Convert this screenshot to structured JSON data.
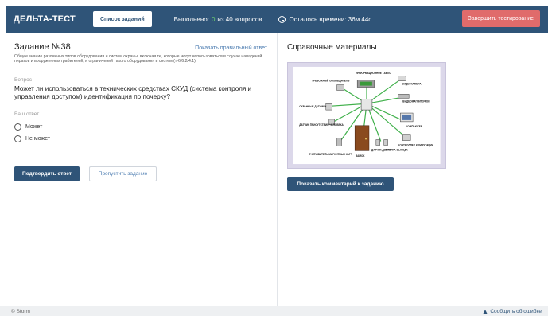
{
  "header": {
    "logo": "ДЕЛЬТА-ТЕСТ",
    "task_list_button": "Список заданий",
    "progress_prefix": "Выполнено:",
    "progress_done": "0",
    "progress_suffix": "из 40 вопросов",
    "timer_text": "Осталось времени: 36м 44с",
    "finish_button": "Завершить тестирование"
  },
  "task": {
    "title": "Задание №38",
    "show_answer_link": "Показать правильный ответ",
    "description": "Общее знание различных типов оборудования и систем охраны, включая те, которые могут использоваться в случае нападений пиратов и вооруженных грабителей, и ограничений такого оборудования и систем (т-6/6.2/4.1)",
    "question_label": "Вопрос",
    "question_text": "Может ли использоваться в технических средствах СКУД (система контроля и управления доступом) идентификация по почерку?",
    "answer_label": "Ваш ответ",
    "options": [
      "Может",
      "Не может"
    ],
    "confirm_button": "Подтвердить ответ",
    "skip_button": "Пропустить задание"
  },
  "reference": {
    "title": "Справочные материалы",
    "diagram_labels": {
      "info_board": "ИНФОРМАЦИОННОЕ ТАБЛО",
      "alarm": "ТРЕВОЖНЫЙ ОПОВЕЩАТЕЛЬ",
      "camera": "ВИДЕОКАМЕРА",
      "recorder": "ВИДЕОМАГНИТОФОН",
      "guard_sensors": "ОХРАННЫЕ ДАТЧИКИ",
      "presence_sensors": "ДАТЧИК ПРИСУТСТВИЯ ЧЕЛОВЕКА",
      "computer": "КОМПЬЮТЕР",
      "controller": "КОНТРОЛЛЕР КОММУТАЦИИ",
      "card_reader": "СЧИТЫВАТЕЛЬ МАГНИТНЫХ КАРТ",
      "lock": "ЗАМОК",
      "door_sensor": "ДАТЧИК ДВЕРИ",
      "exit_button": "КНОПКА ВЫХОДА"
    },
    "comment_button": "Показать комментарий к заданию"
  },
  "footer": {
    "copyright": "© Storm",
    "report_link": "Сообщить об ошибке"
  },
  "colors": {
    "header_bg": "#2f5478",
    "finish_button": "#e06b6b",
    "progress_done": "#6fd36f",
    "link": "#4a7bb0"
  },
  "icons": {
    "timer": "clock-icon",
    "report": "warning-triangle-icon"
  }
}
